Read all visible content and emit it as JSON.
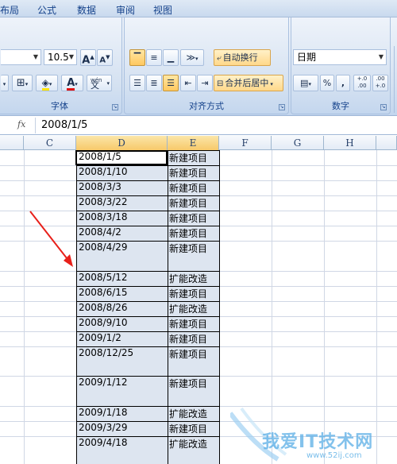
{
  "menu": {
    "tabs": [
      "布局",
      "公式",
      "数据",
      "审阅",
      "视图"
    ]
  },
  "ribbon": {
    "font": {
      "label": "字体",
      "size_value": "10.5",
      "grow_label": "A",
      "shrink_label": "A",
      "font_color_label": "A",
      "phonetic_label": "文"
    },
    "alignment": {
      "label": "对齐方式",
      "wrap_text_label": "自动换行",
      "merge_center_label": "合并后居中"
    },
    "number": {
      "label": "数字",
      "format_value": "日期",
      "percent_label": "%",
      "comma_label": ",",
      "inc_decimal_label": "+.0 .00",
      "dec_decimal_label": ".00 +.0"
    }
  },
  "formula_bar": {
    "fx_label": "fx",
    "value": "2008/1/5"
  },
  "columns": [
    "C",
    "D",
    "E",
    "F",
    "G",
    "H"
  ],
  "rows": [
    {
      "date": "2008/1/5",
      "type": "新建项目"
    },
    {
      "date": "2008/1/10",
      "type": "新建项目"
    },
    {
      "date": "2008/3/3",
      "type": "新建项目"
    },
    {
      "date": "2008/3/22",
      "type": "新建项目"
    },
    {
      "date": "2008/3/18",
      "type": "新建项目"
    },
    {
      "date": "2008/4/2",
      "type": "新建项目"
    },
    {
      "date": "2008/4/29",
      "type": "新建项目"
    },
    {
      "date": "2008/5/12",
      "type": "扩能改造"
    },
    {
      "date": "2008/6/15",
      "type": "新建项目"
    },
    {
      "date": "2008/8/26",
      "type": "扩能改造"
    },
    {
      "date": "2008/9/10",
      "type": "新建项目"
    },
    {
      "date": "2009/1/2",
      "type": "新建项目"
    },
    {
      "date": "2008/12/25",
      "type": "新建项目"
    },
    {
      "date": "2009/1/12",
      "type": "新建项目"
    },
    {
      "date": "2009/1/18",
      "type": "扩能改造"
    },
    {
      "date": "2009/3/29",
      "type": "新建项目"
    },
    {
      "date": "2009/4/18",
      "type": "扩能改造"
    }
  ],
  "watermark": {
    "text": "我爱IT技术网",
    "url": "www.52ij.com"
  },
  "colors": {
    "annotation_arrow": "#e8201a",
    "selection_fill": "#dde5f0",
    "ribbon_text": "#15428b"
  }
}
